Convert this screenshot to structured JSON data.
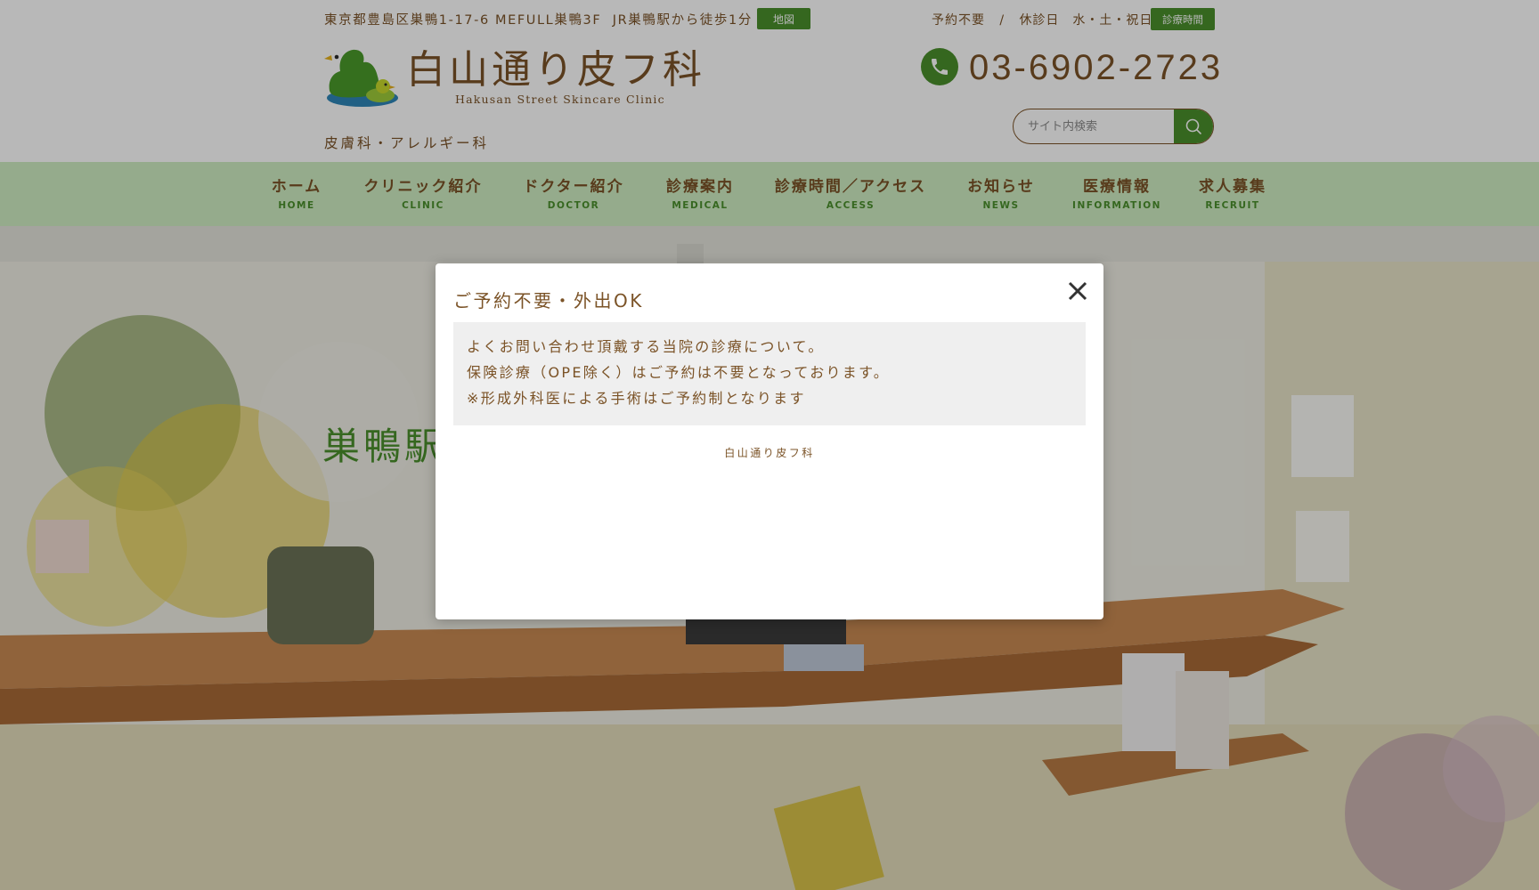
{
  "header": {
    "address": "東京都豊島区巣鴨1-17-6 MEFULL巣鴨3F",
    "access": "JR巣鴨駅から徒歩1分",
    "map_button": "地図",
    "no_reservation": "予約不要",
    "separator": "/",
    "closed_days": "休診日　水・土・祝日",
    "hours_button": "診療時間",
    "logo_name": "白山通り皮フ科",
    "logo_sub": "Hakusan Street Skincare Clinic",
    "tagline": "皮膚科・アレルギー科",
    "phone": "03-6902-2723",
    "search_placeholder": "サイト内検索"
  },
  "nav": [
    {
      "jp": "ホーム",
      "en": "HOME"
    },
    {
      "jp": "クリニック紹介",
      "en": "CLINIC"
    },
    {
      "jp": "ドクター紹介",
      "en": "DOCTOR"
    },
    {
      "jp": "診療案内",
      "en": "MEDICAL"
    },
    {
      "jp": "診療時間／アクセス",
      "en": "ACCESS"
    },
    {
      "jp": "お知らせ",
      "en": "NEWS"
    },
    {
      "jp": "医療情報",
      "en": "INFORMATION"
    },
    {
      "jp": "求人募集",
      "en": "RECRUIT"
    }
  ],
  "hero": {
    "title_visible": "巣鴨駅"
  },
  "modal": {
    "title": "ご予約不要・外出OK",
    "lines": [
      "よくお問い合わせ頂戴する当院の診療について。",
      "保険診療（OPE除く）はご予約は不要となっております。",
      "※形成外科医による手術はご予約制となります"
    ],
    "footer": "白山通り皮フ科"
  },
  "colors": {
    "brand_brown": "#7b5327",
    "brand_green": "#4a8f2c",
    "nav_bg": "#cfeec2"
  },
  "icons": [
    "duck-logo-icon",
    "phone-icon",
    "search-icon",
    "close-icon"
  ]
}
